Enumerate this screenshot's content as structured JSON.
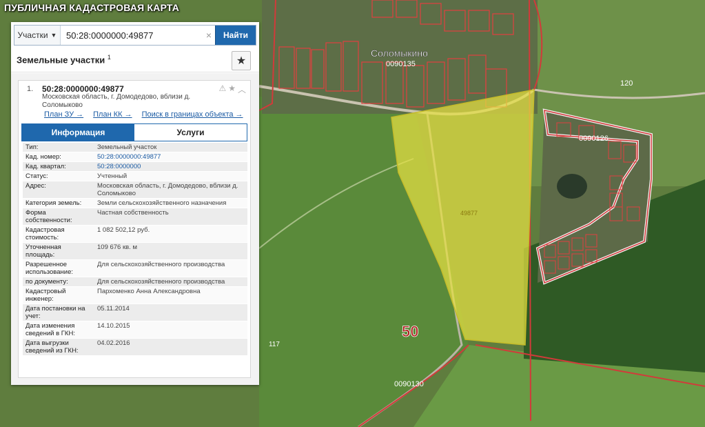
{
  "app": {
    "title": "ПУБЛИЧНАЯ КАДАСТРОВАЯ КАРТА"
  },
  "search": {
    "type_label": "Участки",
    "query": "50:28:0000000:49877",
    "button_label": "Найти"
  },
  "panel": {
    "section_title": "Земельные участки",
    "section_count": "1"
  },
  "result": {
    "index": "1.",
    "title": "50:28:0000000:49877",
    "address": "Московская область, г. Домодедово, вблизи д. Соломыково",
    "links": [
      "План ЗУ →",
      "План КК →",
      "Поиск в границах объекта →"
    ],
    "tabs": [
      "Информация",
      "Услуги"
    ],
    "fields": [
      {
        "k": "Тип:",
        "v": "Земельный участок"
      },
      {
        "k": "Кад. номер:",
        "v": "50:28:0000000:49877",
        "link": true
      },
      {
        "k": "Кад. квартал:",
        "v": "50:28:0000000",
        "link": true
      },
      {
        "k": "Статус:",
        "v": "Учтенный"
      },
      {
        "k": "Адрес:",
        "v": "Московская область, г. Домодедово, вблизи д. Соломыково"
      },
      {
        "k": "Категория земель:",
        "v": "Земли сельскохозяйственного назначения"
      },
      {
        "k": "Форма собственности:",
        "v": "Частная собственность"
      },
      {
        "k": "Кадастровая стоимость:",
        "v": "1 082 502,12 руб."
      },
      {
        "k": "Уточненная площадь:",
        "v": "109 676 кв. м"
      },
      {
        "k": "Разрешенное использование:",
        "v": "Для сельскохозяйственного производства"
      },
      {
        "k": "по документу:",
        "v": "Для сельскохозяйственного производства"
      },
      {
        "k": "Кадастровый инженер:",
        "v": "Пархоменко Анна Александровна"
      },
      {
        "k": "Дата постановки на учет:",
        "v": "05.11.2014"
      },
      {
        "k": "Дата изменения сведений в ГКН:",
        "v": "14.10.2015"
      },
      {
        "k": "Дата выгрузки сведений из ГКН:",
        "v": "04.02.2016"
      }
    ]
  },
  "map_labels": {
    "village": "Соломыкино",
    "quarter_village": "0090135",
    "quarter_east": "0090126",
    "quarter_south": "0090130",
    "district": "50",
    "parcel": "49877",
    "lot_120": "120",
    "lot_117": "117"
  },
  "colors": {
    "accent": "#1f68ad",
    "parcel_fill": "#e6e042",
    "boundary": "#d23a3a"
  }
}
